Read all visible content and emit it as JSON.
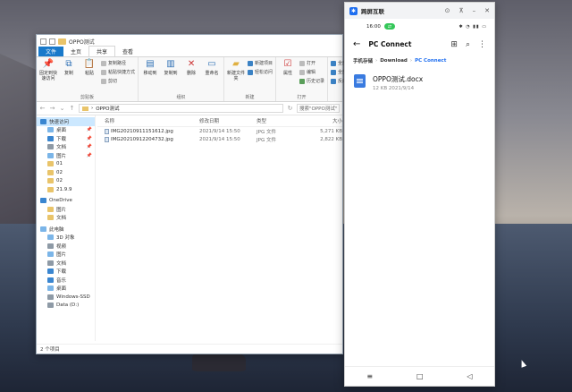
{
  "explorer": {
    "title": "OPPO测试",
    "tabs": [
      "文件",
      "主页",
      "共享",
      "查看"
    ],
    "ribbon": {
      "clipboard": {
        "pin": "固定到快速访问",
        "copy": "复制",
        "paste": "粘贴",
        "copy_path": "复制路径",
        "paste_shortcut": "粘贴快捷方式",
        "cut": "剪切",
        "group": "剪贴板"
      },
      "organize": {
        "move_to": "移动到",
        "copy_to": "复制到",
        "delete": "删除",
        "rename": "重命名",
        "group": "组织"
      },
      "new": {
        "new_folder": "新建文件夹",
        "new_item": "新建项目",
        "easy_access": "轻松访问",
        "group": "新建"
      },
      "open": {
        "properties": "属性",
        "open": "打开",
        "edit": "编辑",
        "history": "历史记录",
        "group": "打开"
      },
      "select": {
        "select_all": "全部选择",
        "select_none": "全部取消",
        "invert": "反向选择"
      }
    },
    "address": {
      "path": "OPPO测试",
      "search_placeholder": "搜索\"OPPO测试\""
    },
    "nav_items": [
      {
        "label": "快速访问",
        "icon": "star-icon"
      },
      {
        "label": "桌面",
        "icon": "desktop-icon"
      },
      {
        "label": "下载",
        "icon": "download-icon"
      },
      {
        "label": "文档",
        "icon": "document-icon"
      },
      {
        "label": "图片",
        "icon": "picture-icon"
      },
      {
        "label": "01",
        "icon": "folder-icon"
      },
      {
        "label": "02",
        "icon": "folder-icon"
      },
      {
        "label": "02",
        "icon": "folder-icon"
      },
      {
        "label": "21.9.9",
        "icon": "folder-icon"
      },
      {
        "label": "OneDrive",
        "icon": "cloud-icon"
      },
      {
        "label": "图片",
        "icon": "folder-icon"
      },
      {
        "label": "文档",
        "icon": "folder-icon"
      },
      {
        "label": "此电脑",
        "icon": "computer-icon"
      },
      {
        "label": "3D 对象",
        "icon": "3d-objects-icon"
      },
      {
        "label": "视频",
        "icon": "video-icon"
      },
      {
        "label": "图片",
        "icon": "picture-icon"
      },
      {
        "label": "文档",
        "icon": "document-icon"
      },
      {
        "label": "下载",
        "icon": "download-icon"
      },
      {
        "label": "音乐",
        "icon": "music-icon"
      },
      {
        "label": "桌面",
        "icon": "desktop-icon"
      },
      {
        "label": "Windows-SSD",
        "icon": "drive-icon"
      },
      {
        "label": "Data (D:)",
        "icon": "drive-icon"
      }
    ],
    "columns": {
      "name": "名称",
      "date": "修改日期",
      "type": "类型",
      "size": "大小"
    },
    "files": [
      {
        "name": "IMG20210911151612.jpg",
        "date": "2021/9/14 15:50",
        "type": "JPG 文件",
        "size": "5,271 KB"
      },
      {
        "name": "IMG20210912204732.jpg",
        "date": "2021/9/14 15:50",
        "type": "JPG 文件",
        "size": "2,822 KB"
      }
    ],
    "status": "2 个项目"
  },
  "phone": {
    "app_name": "跨屏互联",
    "time": "16:00",
    "title": "PC Connect",
    "breadcrumb": [
      "手机存储",
      "Download",
      "PC Connect"
    ],
    "file": {
      "name": "OPPO测试.docx",
      "meta": "12 KB  2021/9/14"
    }
  },
  "colors": {
    "accent": "#1e6ef0",
    "ribbon_file_tab": "#1979ca"
  }
}
